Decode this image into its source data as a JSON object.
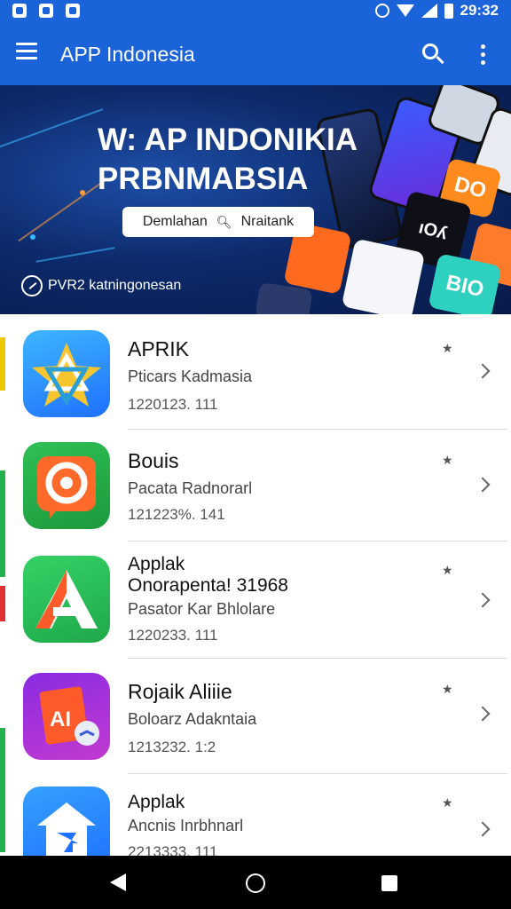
{
  "status_bar": {
    "time": "29:32",
    "icons": [
      "notification-icon",
      "notification-icon",
      "notification-icon",
      "alarm-icon",
      "wifi-icon",
      "signal-icon",
      "battery-icon"
    ]
  },
  "app_bar": {
    "title": "APP Indonesia",
    "icons": [
      "menu-icon",
      "search-icon",
      "more-vert-icon"
    ],
    "color": "#1a63d8"
  },
  "banner": {
    "title_line1": "W: AP INDONIKIA",
    "title_line2": "PRBNMABSIA",
    "search_left": "Demlahan",
    "search_right": "Nraitank",
    "footer": "PVR2 katningonesan",
    "tiles": [
      "DO",
      "ıOʎ",
      "BIO"
    ]
  },
  "apps": [
    {
      "name": "APRIK",
      "subtitle": "Pticars Kadmasia",
      "meta": "1220123. 111",
      "icon_colors": [
        "#1e88ff",
        "#3fc6ff"
      ]
    },
    {
      "name": "Bouis",
      "subtitle": "Pacata Radnorarl",
      "meta": "121223%. 141",
      "icon_colors": [
        "#1f9a3b",
        "#3cc25a"
      ]
    },
    {
      "name": "Applak",
      "name2": "Onorapenta! 31968",
      "subtitle": "Pasator Kar Bhlolare",
      "meta": "1220233. 111",
      "icon_colors": [
        "#27c25a",
        "#1fa84a"
      ]
    },
    {
      "name": "Rojaik Aliiie",
      "subtitle": "Boloarz Adakntaia",
      "meta": "1213232. 1:2",
      "icon_colors": [
        "#7a2bd8",
        "#c03ad0"
      ]
    },
    {
      "name": "Applak",
      "subtitle": "Ancnis Inrbhnarl",
      "meta": "2213333. 111",
      "icon_colors": [
        "#1e70ff",
        "#35a0ff"
      ]
    }
  ],
  "nav": {
    "icons": [
      "back-icon",
      "home-icon",
      "recents-icon"
    ]
  }
}
